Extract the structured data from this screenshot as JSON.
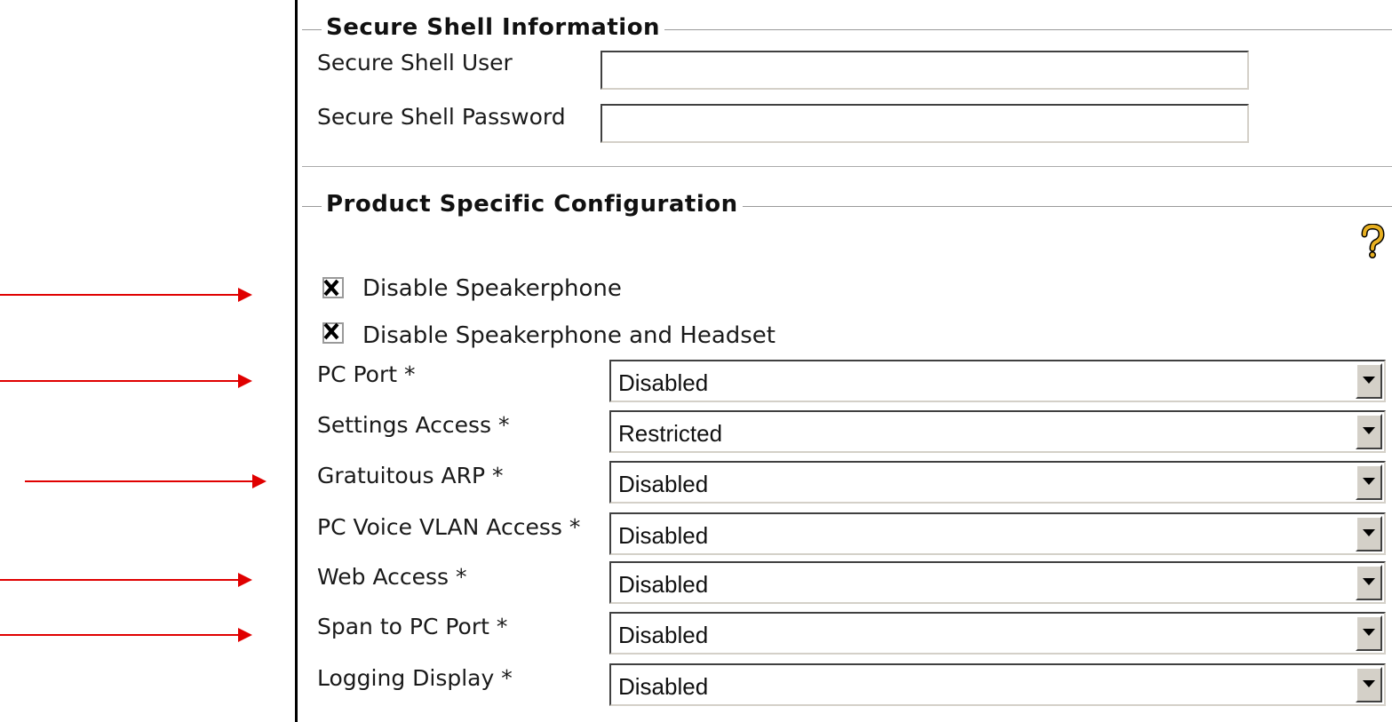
{
  "secure_shell": {
    "legend": "Secure Shell Information",
    "user_label": "Secure Shell User",
    "user_value": "",
    "password_label": "Secure Shell Password",
    "password_value": ""
  },
  "product_config": {
    "legend": "Product Specific Configuration",
    "help_icon": "help-icon",
    "checkboxes": [
      {
        "label": "Disable Speakerphone",
        "checked": true
      },
      {
        "label": "Disable Speakerphone and Headset",
        "checked": true
      }
    ],
    "fields": [
      {
        "label": "PC Port *",
        "value": "Disabled"
      },
      {
        "label": "Settings Access *",
        "value": "Restricted"
      },
      {
        "label": "Gratuitous ARP *",
        "value": "Disabled"
      },
      {
        "label": "PC Voice VLAN Access *",
        "value": "Disabled"
      },
      {
        "label": "Web Access *",
        "value": "Disabled"
      },
      {
        "label": "Span to PC Port *",
        "value": "Disabled"
      },
      {
        "label": "Logging Display *",
        "value": "Disabled"
      }
    ]
  },
  "colors": {
    "annotation_arrow": "#e00000"
  }
}
